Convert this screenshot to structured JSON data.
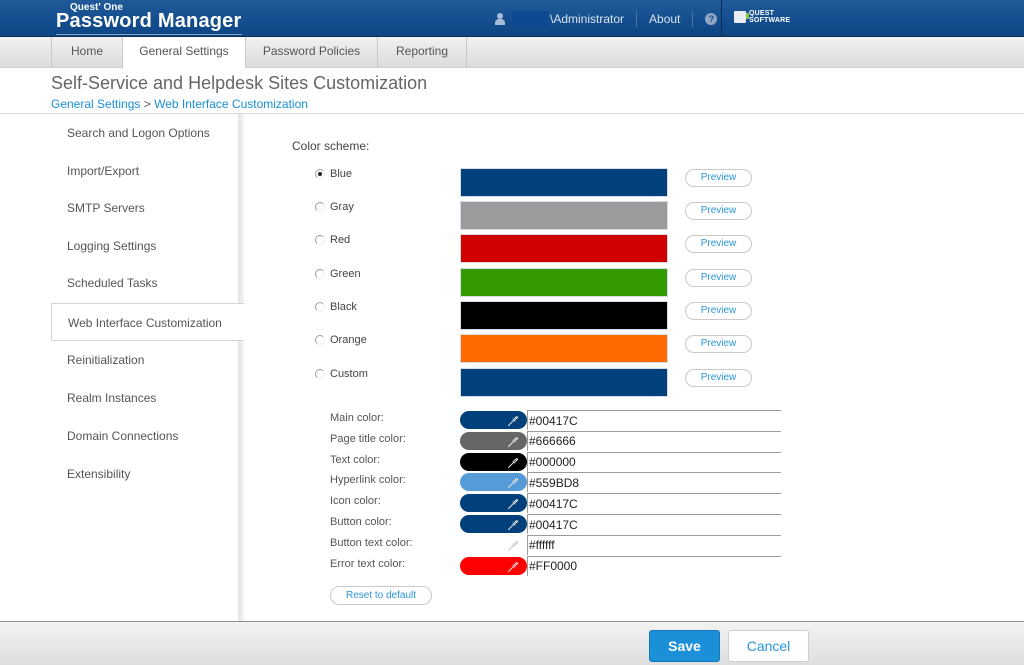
{
  "header": {
    "brand_small": "Quest' One",
    "brand_big": "Password Manager",
    "user_label": "\\Administrator",
    "about_label": "About",
    "help_icon": "question-circle-icon",
    "vendor_line1": "QUEST",
    "vendor_line2": "SOFTWARE"
  },
  "tabs": [
    {
      "label": "Home"
    },
    {
      "label": "General Settings",
      "active": true
    },
    {
      "label": "Password Policies"
    },
    {
      "label": "Reporting"
    }
  ],
  "page": {
    "title": "Self-Service and Helpdesk Sites Customization",
    "breadcrumb": {
      "parent": "General Settings",
      "separator": " > ",
      "current": "Web Interface Customization"
    }
  },
  "sidebar": {
    "items": [
      {
        "label": "Search and Logon Options"
      },
      {
        "label": "Import/Export"
      },
      {
        "label": "SMTP Servers"
      },
      {
        "label": "Logging Settings"
      },
      {
        "label": "Scheduled Tasks"
      },
      {
        "label": "Web Interface Customization",
        "active": true
      },
      {
        "label": "Reinitialization"
      },
      {
        "label": "Realm Instances"
      },
      {
        "label": "Domain Connections"
      },
      {
        "label": "Extensibility"
      }
    ]
  },
  "color_scheme": {
    "label": "Color scheme:",
    "preview_label": "Preview",
    "schemes": [
      {
        "name": "Blue",
        "color": "#00417C",
        "selected": true
      },
      {
        "name": "Gray",
        "color": "#9B9A9C",
        "selected": false
      },
      {
        "name": "Red",
        "color": "#D00000",
        "selected": false
      },
      {
        "name": "Green",
        "color": "#339A00",
        "selected": false
      },
      {
        "name": "Black",
        "color": "#000000",
        "selected": false
      },
      {
        "name": "Orange",
        "color": "#FF6A00",
        "selected": false
      },
      {
        "name": "Custom",
        "color": "#00417C",
        "selected": false
      }
    ]
  },
  "custom_colors": {
    "fields": [
      {
        "label": "Main color:",
        "value": "#00417C",
        "swatch": "#00417C"
      },
      {
        "label": "Page title color:",
        "value": "#666666",
        "swatch": "#666666"
      },
      {
        "label": "Text color:",
        "value": "#000000",
        "swatch": "#000000"
      },
      {
        "label": "Hyperlink color:",
        "value": "#559BD8",
        "swatch": "#559BD8"
      },
      {
        "label": "Icon color:",
        "value": "#00417C",
        "swatch": "#00417C"
      },
      {
        "label": "Button color:",
        "value": "#00417C",
        "swatch": "#00417C"
      },
      {
        "label": "Button text color:",
        "value": "#ffffff",
        "swatch": "#ffffff"
      },
      {
        "label": "Error text color:",
        "value": "#FF0000",
        "swatch": "#FF0000"
      }
    ],
    "reset_label": "Reset to default"
  },
  "footer": {
    "save_label": "Save",
    "cancel_label": "Cancel"
  }
}
